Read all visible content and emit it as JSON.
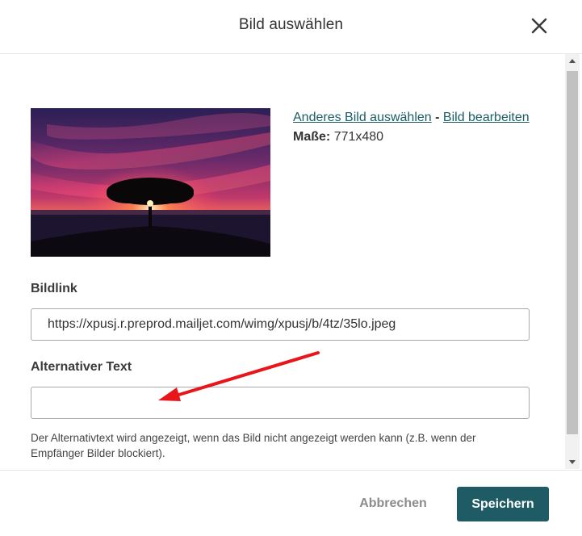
{
  "dialog": {
    "title": "Bild auswählen",
    "close_icon": "close-icon"
  },
  "image": {
    "alt": "Sunset tree image",
    "change_link": "Anderes Bild auswählen",
    "separator": "-",
    "edit_link": "Bild bearbeiten",
    "dims_label": "Maße:",
    "dims_value": "771x480"
  },
  "bildlink": {
    "label": "Bildlink",
    "value": "https://xpusj.r.preprod.mailjet.com/wimg/xpusj/b/4tz/35lo.jpeg"
  },
  "alt_text": {
    "label": "Alternativer Text",
    "value": "",
    "help": "Der Alternativtext wird angezeigt, wenn das Bild nicht angezeigt werden kann (z.B. wenn der Empfänger Bilder blockiert)."
  },
  "footer": {
    "cancel_label": "Abbrechen",
    "save_label": "Speichern"
  },
  "colors": {
    "accent": "#1f5b64",
    "link": "#1c5c63",
    "annotation_arrow": "#e8161a"
  }
}
